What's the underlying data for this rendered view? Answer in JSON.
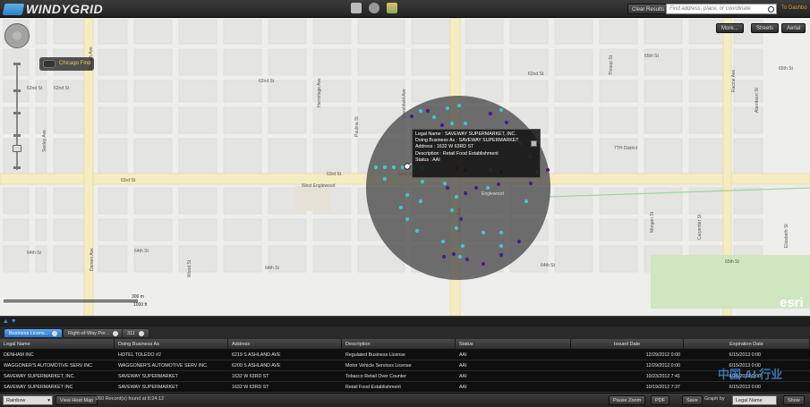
{
  "header": {
    "logo_text": "WINDYGRID",
    "clear_results": "Clear Results",
    "search_placeholder": "Find address, place, or coordinate",
    "to_dashboard": "To Dashbo"
  },
  "map": {
    "more_button": "More...",
    "streets_button": "Streets",
    "aerial_button": "Aerial",
    "chicago_find": "Chicago Find",
    "scale_top": "300 m",
    "scale_bottom": "1000 ft",
    "esri": "esri",
    "streets": {
      "s62nd_a": "62nd St",
      "s62nd_b": "62nd St",
      "s62nd_c": "62nd St",
      "s62nd_d": "62nd St",
      "s63rd_a": "63rd St",
      "s63rd_b": "63rd St",
      "s63rd_c": "63rd St",
      "s64th_a": "64th St",
      "s64th_b": "64th St",
      "s64th_c": "64th St",
      "s64th_d": "64th St",
      "s65th_a": "65th St",
      "s65th_b": "65th St",
      "s65th_c": "65th St",
      "hermitage": "Hermitage Ave",
      "paulina": "Paulina St",
      "marshfield": "Marshfield Ave",
      "damen_a": "Damen Ave",
      "damen_b": "Damen Ave",
      "seeley": "Seeley Ave",
      "wood": "Wood St",
      "ashland": "Ashland Ave",
      "throop": "Throop St",
      "morgan": "Morgan St",
      "carpenter": "Carpenter St",
      "racine": "Racine Ave",
      "aberdeen": "Aberdeen St",
      "elizabeth": "Elizabeth St",
      "west_englewood": "West Englewood",
      "seventh_district": "7TH District",
      "englewood": "Englewood"
    },
    "popup": {
      "legal_name": "Legal Name : SAVEWAY SUPERMARKET, INC.",
      "doing_business_as": "Doing Business As : SAVEWAY SUPERMARKET",
      "address": "Address : 1632 W 63RD ST",
      "description": "Description : Retail Food Establishment",
      "status": "Status : AAI"
    }
  },
  "tabs": [
    {
      "label": "Business Licens..."
    },
    {
      "label": "Right-of-Way Per..."
    },
    {
      "label": "311"
    }
  ],
  "table": {
    "columns": [
      "Legal Name",
      "Doing Business As",
      "Address",
      "Description",
      "Status",
      "Issued Date",
      "Expiration Date"
    ],
    "rows": [
      [
        "DENHAM INC",
        "HOTEL TOLEDO #2",
        "6219 S ASHLAND AVE",
        "Regulated Business License",
        "AAI",
        "12/29/2012 0:00",
        "6/15/2013 0:00"
      ],
      [
        "WAGGONER'S AUTOMOTIVE SERV INC",
        "WAGGONER'S AUTOMOTIVE SERV INC",
        "6200 S ASHLAND AVE",
        "Motor Vehicle Services License",
        "AAI",
        "12/29/2012 0:00",
        "6/15/2013 0:00"
      ],
      [
        "SAVEWAY SUPERMARKET, INC.",
        "SAVEWAY SUPERMARKET",
        "1632 W 63RD ST",
        "Tobacco Retail Over Counter",
        "AAI",
        "10/23/2012 7:41",
        "6/15/2013 0:00"
      ],
      [
        "SAVEWAY SUPERMARKET INC",
        "SAVEWAY SUPERMARKET",
        "1632 W 63RD ST",
        "Retail Food Establishment",
        "AAI",
        "10/19/2012 7:37",
        "6/15/2013 0:00"
      ]
    ]
  },
  "bottom": {
    "palette": "Rainbow",
    "view_heat_map": "View Heat Map",
    "status": "260 Record(s) found at 8:24:12",
    "pause_zoom": "Pause Zoom",
    "pdf": "PDF",
    "save": "Save",
    "graph": "Graph by",
    "graph_field": "Legal Name",
    "show": "Show"
  },
  "watermark": "中国 AI 行业"
}
